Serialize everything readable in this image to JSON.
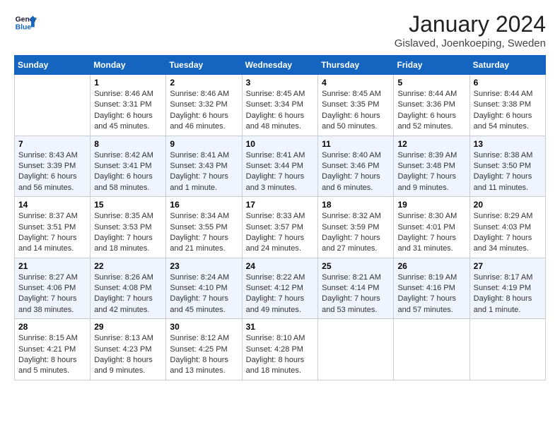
{
  "header": {
    "logo_line1": "General",
    "logo_line2": "Blue",
    "month_title": "January 2024",
    "location": "Gislaved, Joenkoeping, Sweden"
  },
  "days_of_week": [
    "Sunday",
    "Monday",
    "Tuesday",
    "Wednesday",
    "Thursday",
    "Friday",
    "Saturday"
  ],
  "weeks": [
    [
      {
        "day": "",
        "sunrise": "",
        "sunset": "",
        "daylight": ""
      },
      {
        "day": "1",
        "sunrise": "Sunrise: 8:46 AM",
        "sunset": "Sunset: 3:31 PM",
        "daylight": "Daylight: 6 hours and 45 minutes."
      },
      {
        "day": "2",
        "sunrise": "Sunrise: 8:46 AM",
        "sunset": "Sunset: 3:32 PM",
        "daylight": "Daylight: 6 hours and 46 minutes."
      },
      {
        "day": "3",
        "sunrise": "Sunrise: 8:45 AM",
        "sunset": "Sunset: 3:34 PM",
        "daylight": "Daylight: 6 hours and 48 minutes."
      },
      {
        "day": "4",
        "sunrise": "Sunrise: 8:45 AM",
        "sunset": "Sunset: 3:35 PM",
        "daylight": "Daylight: 6 hours and 50 minutes."
      },
      {
        "day": "5",
        "sunrise": "Sunrise: 8:44 AM",
        "sunset": "Sunset: 3:36 PM",
        "daylight": "Daylight: 6 hours and 52 minutes."
      },
      {
        "day": "6",
        "sunrise": "Sunrise: 8:44 AM",
        "sunset": "Sunset: 3:38 PM",
        "daylight": "Daylight: 6 hours and 54 minutes."
      }
    ],
    [
      {
        "day": "7",
        "sunrise": "Sunrise: 8:43 AM",
        "sunset": "Sunset: 3:39 PM",
        "daylight": "Daylight: 6 hours and 56 minutes."
      },
      {
        "day": "8",
        "sunrise": "Sunrise: 8:42 AM",
        "sunset": "Sunset: 3:41 PM",
        "daylight": "Daylight: 6 hours and 58 minutes."
      },
      {
        "day": "9",
        "sunrise": "Sunrise: 8:41 AM",
        "sunset": "Sunset: 3:43 PM",
        "daylight": "Daylight: 7 hours and 1 minute."
      },
      {
        "day": "10",
        "sunrise": "Sunrise: 8:41 AM",
        "sunset": "Sunset: 3:44 PM",
        "daylight": "Daylight: 7 hours and 3 minutes."
      },
      {
        "day": "11",
        "sunrise": "Sunrise: 8:40 AM",
        "sunset": "Sunset: 3:46 PM",
        "daylight": "Daylight: 7 hours and 6 minutes."
      },
      {
        "day": "12",
        "sunrise": "Sunrise: 8:39 AM",
        "sunset": "Sunset: 3:48 PM",
        "daylight": "Daylight: 7 hours and 9 minutes."
      },
      {
        "day": "13",
        "sunrise": "Sunrise: 8:38 AM",
        "sunset": "Sunset: 3:50 PM",
        "daylight": "Daylight: 7 hours and 11 minutes."
      }
    ],
    [
      {
        "day": "14",
        "sunrise": "Sunrise: 8:37 AM",
        "sunset": "Sunset: 3:51 PM",
        "daylight": "Daylight: 7 hours and 14 minutes."
      },
      {
        "day": "15",
        "sunrise": "Sunrise: 8:35 AM",
        "sunset": "Sunset: 3:53 PM",
        "daylight": "Daylight: 7 hours and 18 minutes."
      },
      {
        "day": "16",
        "sunrise": "Sunrise: 8:34 AM",
        "sunset": "Sunset: 3:55 PM",
        "daylight": "Daylight: 7 hours and 21 minutes."
      },
      {
        "day": "17",
        "sunrise": "Sunrise: 8:33 AM",
        "sunset": "Sunset: 3:57 PM",
        "daylight": "Daylight: 7 hours and 24 minutes."
      },
      {
        "day": "18",
        "sunrise": "Sunrise: 8:32 AM",
        "sunset": "Sunset: 3:59 PM",
        "daylight": "Daylight: 7 hours and 27 minutes."
      },
      {
        "day": "19",
        "sunrise": "Sunrise: 8:30 AM",
        "sunset": "Sunset: 4:01 PM",
        "daylight": "Daylight: 7 hours and 31 minutes."
      },
      {
        "day": "20",
        "sunrise": "Sunrise: 8:29 AM",
        "sunset": "Sunset: 4:03 PM",
        "daylight": "Daylight: 7 hours and 34 minutes."
      }
    ],
    [
      {
        "day": "21",
        "sunrise": "Sunrise: 8:27 AM",
        "sunset": "Sunset: 4:06 PM",
        "daylight": "Daylight: 7 hours and 38 minutes."
      },
      {
        "day": "22",
        "sunrise": "Sunrise: 8:26 AM",
        "sunset": "Sunset: 4:08 PM",
        "daylight": "Daylight: 7 hours and 42 minutes."
      },
      {
        "day": "23",
        "sunrise": "Sunrise: 8:24 AM",
        "sunset": "Sunset: 4:10 PM",
        "daylight": "Daylight: 7 hours and 45 minutes."
      },
      {
        "day": "24",
        "sunrise": "Sunrise: 8:22 AM",
        "sunset": "Sunset: 4:12 PM",
        "daylight": "Daylight: 7 hours and 49 minutes."
      },
      {
        "day": "25",
        "sunrise": "Sunrise: 8:21 AM",
        "sunset": "Sunset: 4:14 PM",
        "daylight": "Daylight: 7 hours and 53 minutes."
      },
      {
        "day": "26",
        "sunrise": "Sunrise: 8:19 AM",
        "sunset": "Sunset: 4:16 PM",
        "daylight": "Daylight: 7 hours and 57 minutes."
      },
      {
        "day": "27",
        "sunrise": "Sunrise: 8:17 AM",
        "sunset": "Sunset: 4:19 PM",
        "daylight": "Daylight: 8 hours and 1 minute."
      }
    ],
    [
      {
        "day": "28",
        "sunrise": "Sunrise: 8:15 AM",
        "sunset": "Sunset: 4:21 PM",
        "daylight": "Daylight: 8 hours and 5 minutes."
      },
      {
        "day": "29",
        "sunrise": "Sunrise: 8:13 AM",
        "sunset": "Sunset: 4:23 PM",
        "daylight": "Daylight: 8 hours and 9 minutes."
      },
      {
        "day": "30",
        "sunrise": "Sunrise: 8:12 AM",
        "sunset": "Sunset: 4:25 PM",
        "daylight": "Daylight: 8 hours and 13 minutes."
      },
      {
        "day": "31",
        "sunrise": "Sunrise: 8:10 AM",
        "sunset": "Sunset: 4:28 PM",
        "daylight": "Daylight: 8 hours and 18 minutes."
      },
      {
        "day": "",
        "sunrise": "",
        "sunset": "",
        "daylight": ""
      },
      {
        "day": "",
        "sunrise": "",
        "sunset": "",
        "daylight": ""
      },
      {
        "day": "",
        "sunrise": "",
        "sunset": "",
        "daylight": ""
      }
    ]
  ]
}
